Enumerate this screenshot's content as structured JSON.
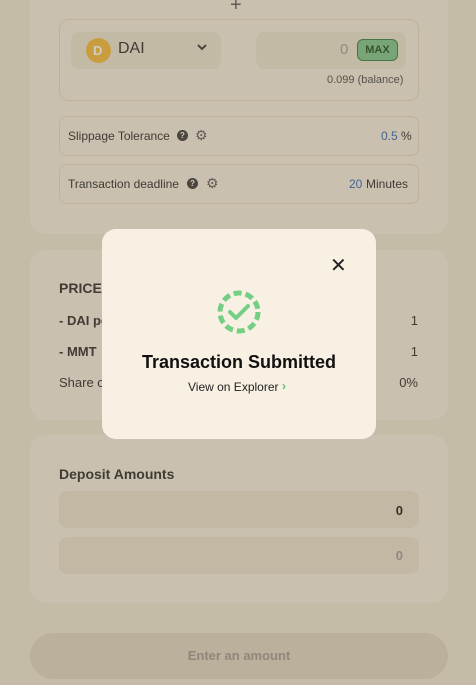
{
  "top_card": {
    "plus_symbol": "+",
    "token": {
      "symbol": "DAI",
      "logo_letter": "D",
      "logo_color": "#f4b731"
    },
    "amount_value": "0",
    "max_label": "MAX",
    "balance_text": "0.099 (balance)"
  },
  "settings": {
    "slippage": {
      "label": "Slippage Tolerance",
      "value": "0.5",
      "unit": "%"
    },
    "deadline": {
      "label": "Transaction deadline",
      "value": "20",
      "unit": "Minutes"
    }
  },
  "prices": {
    "title": "PRICES",
    "rows": [
      {
        "label": "- DAI pe",
        "value": "1"
      },
      {
        "label": "- MMT",
        "value": "1"
      }
    ],
    "share_label": "Share o",
    "share_value": "0%"
  },
  "deposit": {
    "title": "Deposit Amounts",
    "amounts": [
      "0",
      "0"
    ]
  },
  "action_button_label": "Enter an amount",
  "modal": {
    "title": "Transaction Submitted",
    "link_label": "View on Explorer",
    "close_symbol": "✕",
    "link_chevron": "›",
    "success_color": "#74cf85"
  }
}
